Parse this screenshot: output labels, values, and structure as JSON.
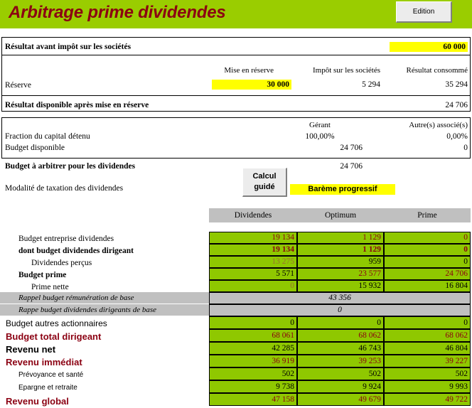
{
  "banner": {
    "title": "Arbitrage prime dividendes",
    "edition_button": "Edition",
    "green": "#9ACD00",
    "title_color": "#8B0012"
  },
  "section_result": {
    "row_label": "Résultat avant impôt sur les sociétés",
    "row_value": "60 000",
    "col_headers": [
      "Mise en réserve",
      "Impôt sur les sociétés",
      "Résultat consommé"
    ],
    "reserve_label": "Réserve",
    "reserve_values": [
      "30 000",
      "5 294",
      "35 294"
    ],
    "available_label": "Résultat disponible après mise en réserve",
    "available_value": "24 706"
  },
  "section_capital": {
    "col_headers": [
      "Gérant",
      "Autre(s) associé(s)"
    ],
    "rows": [
      {
        "label": "Fraction du capital détenu",
        "gerant": "100,00%",
        "autres": "0,00%"
      },
      {
        "label": "Budget disponible",
        "gerant": "24 706",
        "autres": "0"
      }
    ],
    "arbitrage_label": "Budget à arbitrer pour les dividendes",
    "arbitrage_value": "24 706",
    "modalite_label": "Modalité de taxation des dividendes",
    "calcul_button": "Calcul guidé",
    "calcul_button_line1": "Calcul",
    "calcul_button_line2": "guidé",
    "bareme": "Barème progressif"
  },
  "table": {
    "columns": [
      "Dividendes",
      "Optimum",
      "Prime"
    ],
    "rows": [
      {
        "label": "Budget entreprise dividendes",
        "style": "serif",
        "values": [
          "19 134",
          "1 129",
          "0"
        ],
        "value_colors": [
          "red",
          "red",
          "red"
        ]
      },
      {
        "label": "dont budget dividendes dirigeant",
        "style": "serif-bold",
        "values": [
          "19 134",
          "1 129",
          "0"
        ],
        "value_colors": [
          "red",
          "red",
          "red"
        ]
      },
      {
        "label": "Dividendes perçus",
        "style": "serif-indent",
        "values": [
          "13 275",
          "959",
          "0"
        ],
        "value_colors": [
          "dim",
          "black",
          "black"
        ]
      },
      {
        "label": "Budget prime",
        "style": "serif-bold",
        "values": [
          "5 571",
          "23 577",
          "24 706"
        ],
        "value_colors": [
          "black",
          "red",
          "red"
        ]
      },
      {
        "label": "Prime nette",
        "style": "serif-indent",
        "values": [
          "0",
          "15 932",
          "16 804"
        ],
        "value_colors": [
          "dim",
          "black",
          "black"
        ]
      }
    ],
    "merged_rows": [
      {
        "label": "Rappel budget rémunération de base",
        "value": "43 356"
      },
      {
        "label": "Rappe budget dividendes dirigeants de base",
        "value": "0"
      }
    ],
    "bottom_rows": [
      {
        "label": "Budget autres actionnaires",
        "style": "sans",
        "label_color": "black",
        "values": [
          "0",
          "0",
          "0"
        ],
        "value_colors": [
          "black",
          "black",
          "black"
        ]
      },
      {
        "label": "Budget total dirigeant",
        "style": "sans-bold",
        "label_color": "red",
        "values": [
          "68 061",
          "68 062",
          "68 062"
        ],
        "value_colors": [
          "red",
          "red",
          "red"
        ]
      },
      {
        "label": "Revenu net",
        "style": "sans-bold",
        "label_color": "black",
        "values": [
          "42 285",
          "46 743",
          "46 804"
        ],
        "value_colors": [
          "black",
          "black",
          "black"
        ]
      },
      {
        "label": "Revenu immédiat",
        "style": "sans-bold",
        "label_color": "red",
        "values": [
          "36 919",
          "39 253",
          "39 227"
        ],
        "value_colors": [
          "red",
          "red",
          "red"
        ]
      },
      {
        "label": "Prévoyance et santé",
        "style": "sans-small",
        "label_color": "black",
        "values": [
          "502",
          "502",
          "502"
        ],
        "value_colors": [
          "black",
          "black",
          "black"
        ]
      },
      {
        "label": "Epargne et retraite",
        "style": "sans-small",
        "label_color": "black",
        "values": [
          "9 738",
          "9 924",
          "9 993"
        ],
        "value_colors": [
          "black",
          "black",
          "black"
        ]
      },
      {
        "label": "Revenu global",
        "style": "sans-bold",
        "label_color": "red",
        "values": [
          "47 158",
          "49 679",
          "49 722"
        ],
        "value_colors": [
          "red",
          "red",
          "red"
        ]
      }
    ]
  },
  "colors": {
    "green_cell": "#8FC800",
    "banner_green": "#9ACD00",
    "gray": "#C0C0C0",
    "yellow": "#FFFF00",
    "dark_red": "#8B0012"
  }
}
